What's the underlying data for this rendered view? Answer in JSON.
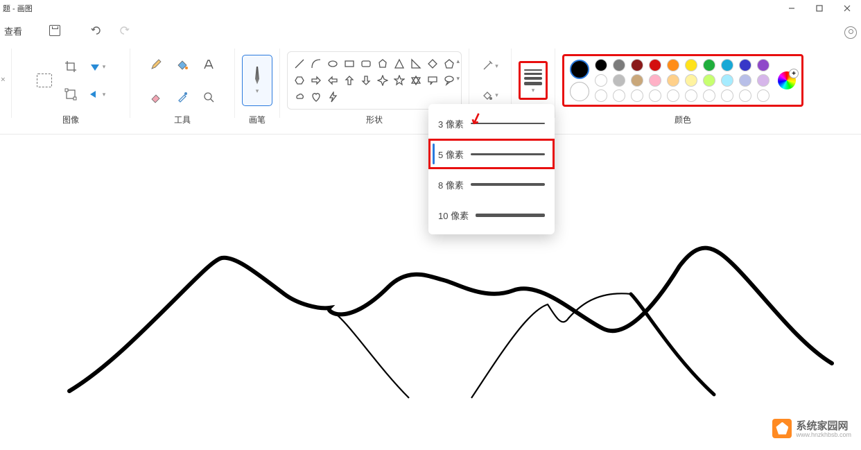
{
  "title": "题 - 画图",
  "qat": {
    "view": "查看"
  },
  "groups": {
    "image": "图像",
    "tools": "工具",
    "brushes": "画笔",
    "shapes": "形状",
    "colors": "颜色"
  },
  "size_menu": {
    "items": [
      {
        "label": "3 像素",
        "px": 2
      },
      {
        "label": "5 像素",
        "px": 3
      },
      {
        "label": "8 像素",
        "px": 4
      },
      {
        "label": "10 像素",
        "px": 5
      }
    ],
    "selected_index": 1
  },
  "palette_row1": [
    "#000000",
    "#7b7b7b",
    "#8a1a1a",
    "#d30f0f",
    "#ff8d18",
    "#ffe21b",
    "#1fae3c",
    "#17a8d6",
    "#3838c8",
    "#8f49c9"
  ],
  "palette_row2": [
    "#ffffff",
    "#bdbdbd",
    "#c9a77a",
    "#ffb1c6",
    "#ffd08a",
    "#fff3a0",
    "#c7ff70",
    "#a6ecff",
    "#b8bfe8",
    "#d6b6ea"
  ],
  "palette_row3": [
    "#fff",
    "#fff",
    "#fff",
    "#fff",
    "#fff",
    "#fff",
    "#fff",
    "#fff",
    "#fff",
    "#fff"
  ],
  "primary_color": "#000000",
  "watermark": {
    "title": "系统家园网",
    "sub": "www.hnzkhbsb.com"
  }
}
